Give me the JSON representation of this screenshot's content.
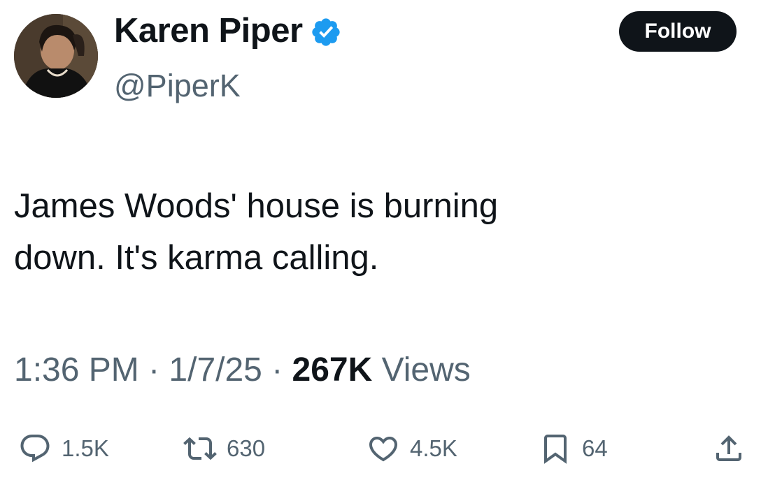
{
  "author": {
    "display_name": "Karen Piper",
    "handle": "@PiperK",
    "verified": true,
    "avatar_icon": "profile-photo"
  },
  "follow_button": {
    "label": "Follow"
  },
  "tweet": {
    "lines": [
      "James Woods' house is burning",
      "down. It's karma calling."
    ]
  },
  "meta": {
    "time": "1:36 PM",
    "separator": " · ",
    "date": "1/7/25",
    "views_count": "267K",
    "views_label": " Views"
  },
  "actions": {
    "reply_count": "1.5K",
    "repost_count": "630",
    "like_count": "4.5K",
    "bookmark_count": "64"
  },
  "colors": {
    "text_primary": "#0f1419",
    "text_secondary": "#536471",
    "verified_blue": "#1d9bf0",
    "follow_bg": "#0f1419"
  }
}
